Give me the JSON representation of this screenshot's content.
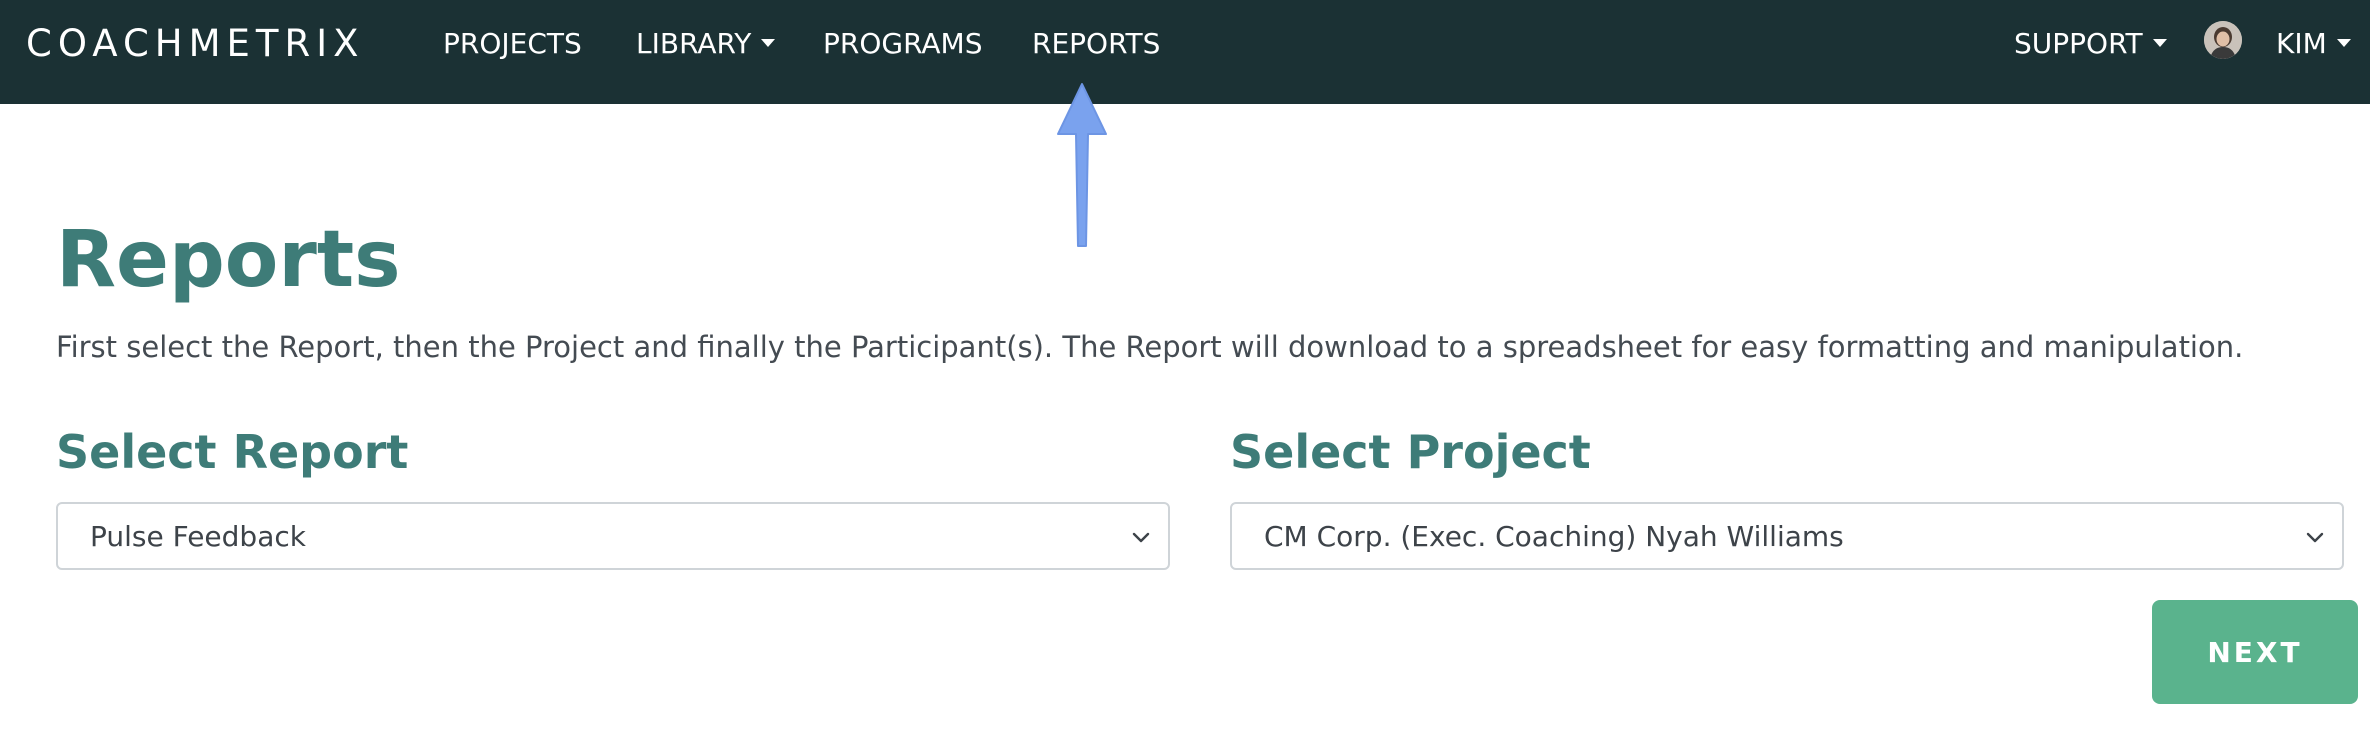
{
  "nav": {
    "brand": "COACHMETRIX",
    "items": [
      {
        "label": "PROJECTS"
      },
      {
        "label": "LIBRARY"
      },
      {
        "label": "PROGRAMS"
      },
      {
        "label": "REPORTS"
      }
    ],
    "support_label": "SUPPORT",
    "user_label": "KIM"
  },
  "main": {
    "title": "Reports",
    "intro": "First select the Report, then the Project and finally the Participant(s). The Report will download to a spreadsheet for easy formatting and manipulation.",
    "report": {
      "label": "Select Report",
      "selected": "Pulse Feedback"
    },
    "project": {
      "label": "Select Project",
      "selected": "CM Corp. (Exec. Coaching) Nyah Williams"
    },
    "next_label": "NEXT"
  },
  "colors": {
    "navbar": "#1b3134",
    "title": "#3e7c78",
    "button": "#5ab38d",
    "annotation_arrow": "#7aa2ee"
  }
}
